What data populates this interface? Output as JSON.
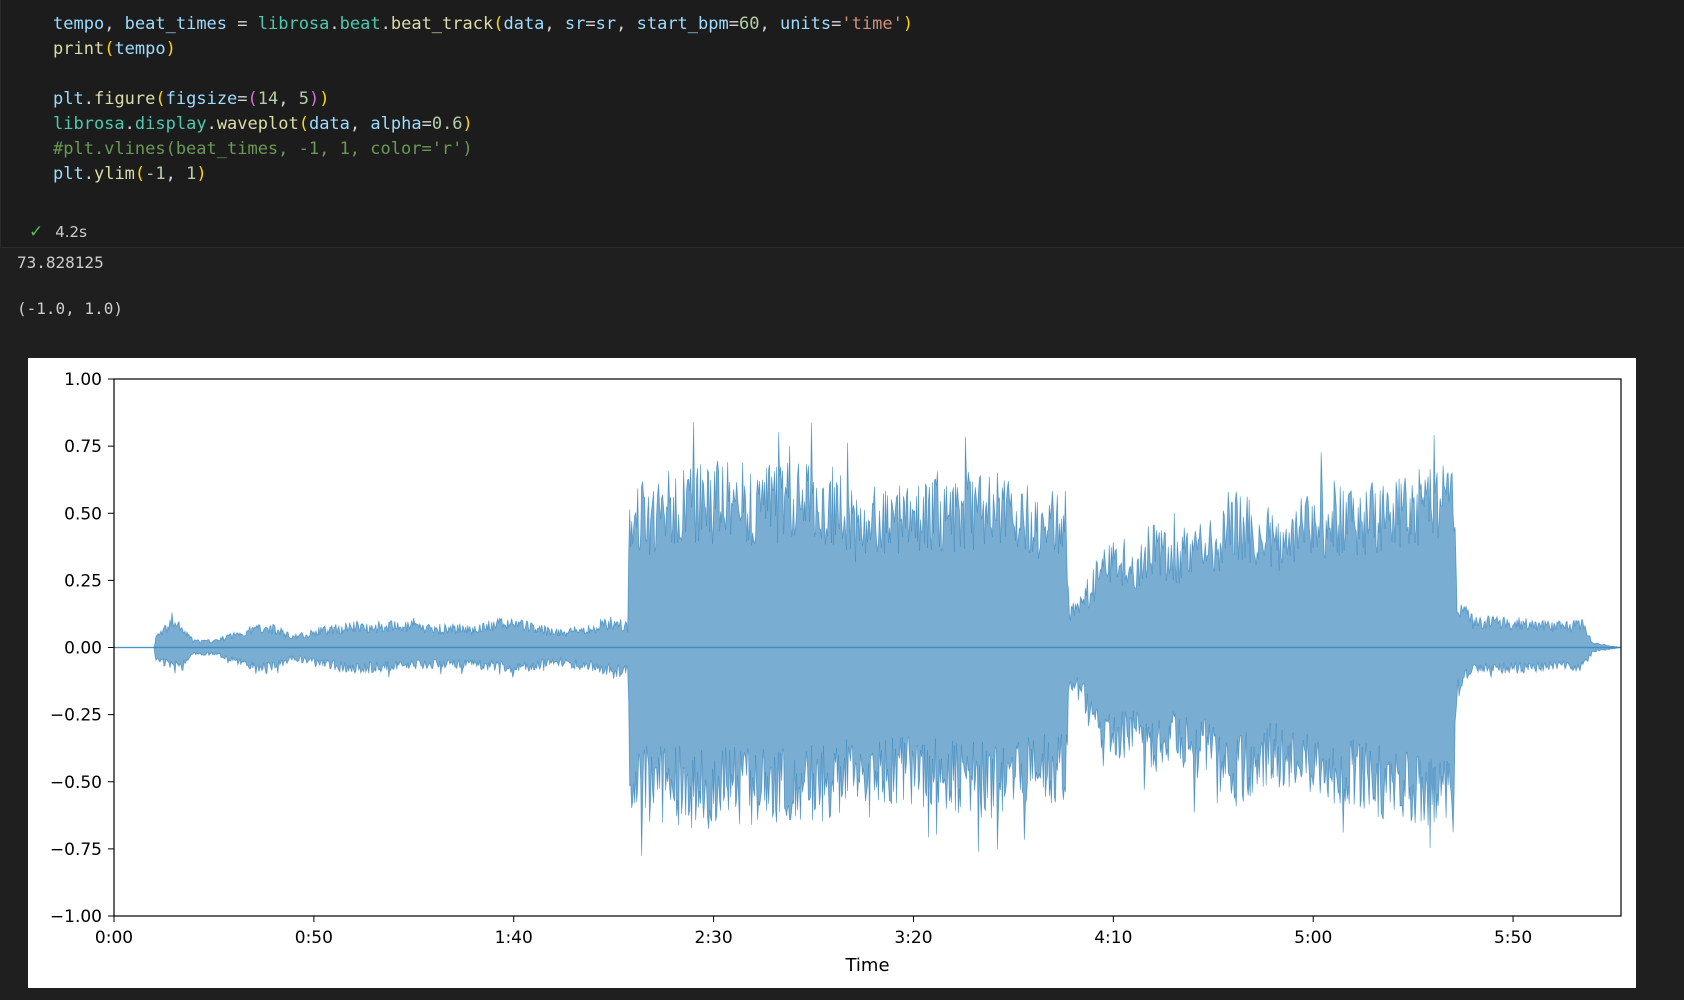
{
  "code_cell": {
    "lines": [
      [
        [
          "tempo",
          "v"
        ],
        [
          ", ",
          "op"
        ],
        [
          "beat_times",
          "v"
        ],
        [
          " = ",
          "op"
        ],
        [
          "librosa",
          "m"
        ],
        [
          ".",
          "op"
        ],
        [
          "beat",
          "m"
        ],
        [
          ".",
          "op"
        ],
        [
          "beat_track",
          "f"
        ],
        [
          "(",
          "p1"
        ],
        [
          "data",
          "v"
        ],
        [
          ", ",
          "op"
        ],
        [
          "sr",
          "v"
        ],
        [
          "=",
          "op"
        ],
        [
          "sr",
          "v"
        ],
        [
          ", ",
          "op"
        ],
        [
          "start_bpm",
          "v"
        ],
        [
          "=",
          "op"
        ],
        [
          "60",
          "n"
        ],
        [
          ", ",
          "op"
        ],
        [
          "units",
          "v"
        ],
        [
          "=",
          "op"
        ],
        [
          "'time'",
          "s"
        ],
        [
          ")",
          "p1"
        ]
      ],
      [
        [
          "print",
          "f"
        ],
        [
          "(",
          "p1"
        ],
        [
          "tempo",
          "v"
        ],
        [
          ")",
          "p1"
        ]
      ],
      [],
      [
        [
          "plt",
          "v"
        ],
        [
          ".",
          "op"
        ],
        [
          "figure",
          "f"
        ],
        [
          "(",
          "p1"
        ],
        [
          "figsize",
          "v"
        ],
        [
          "=",
          "op"
        ],
        [
          "(",
          "p2"
        ],
        [
          "14",
          "n"
        ],
        [
          ", ",
          "op"
        ],
        [
          "5",
          "n"
        ],
        [
          ")",
          "p2"
        ],
        [
          ")",
          "p1"
        ]
      ],
      [
        [
          "librosa",
          "m"
        ],
        [
          ".",
          "op"
        ],
        [
          "display",
          "m"
        ],
        [
          ".",
          "op"
        ],
        [
          "waveplot",
          "f"
        ],
        [
          "(",
          "p1"
        ],
        [
          "data",
          "v"
        ],
        [
          ", ",
          "op"
        ],
        [
          "alpha",
          "v"
        ],
        [
          "=",
          "op"
        ],
        [
          "0.6",
          "n"
        ],
        [
          ")",
          "p1"
        ]
      ],
      [
        [
          "#plt.vlines(beat_times, -1, 1, color='r')",
          "c"
        ]
      ],
      [
        [
          "plt",
          "v"
        ],
        [
          ".",
          "op"
        ],
        [
          "ylim",
          "f"
        ],
        [
          "(",
          "p1"
        ],
        [
          "-1",
          "n"
        ],
        [
          ", ",
          "op"
        ],
        [
          "1",
          "n"
        ],
        [
          ")",
          "p1"
        ]
      ]
    ]
  },
  "execution": {
    "status_icon": "check-icon",
    "duration": "4.2s"
  },
  "outputs": {
    "tempo_value": "73.828125",
    "ylim_value": "(-1.0, 1.0)"
  },
  "chart_data": {
    "type": "area",
    "title": "",
    "xlabel": "Time",
    "ylabel": "",
    "xlim": [
      0,
      377
    ],
    "ylim": [
      -1.0,
      1.0
    ],
    "x_ticks": [
      "0:00",
      "0:50",
      "1:40",
      "2:30",
      "3:20",
      "4:10",
      "5:00",
      "5:50"
    ],
    "x_tick_values": [
      0,
      50,
      100,
      150,
      200,
      250,
      300,
      350
    ],
    "y_ticks": [
      "1.00",
      "0.75",
      "0.50",
      "0.25",
      "0.00",
      "−0.25",
      "−0.50",
      "−0.75",
      "−1.00"
    ],
    "y_tick_values": [
      1.0,
      0.75,
      0.5,
      0.25,
      0.0,
      -0.25,
      -0.5,
      -0.75,
      -1.0
    ],
    "series": [
      {
        "color": "#1f77b4",
        "alpha": 0.6,
        "envelope": {
          "x": [
            0,
            10,
            10.5,
            15,
            20,
            25,
            30,
            38,
            45,
            52,
            60,
            70,
            80,
            90,
            100,
            110,
            120,
            125,
            128.5,
            129,
            135,
            140,
            150,
            160,
            170,
            180,
            185,
            186,
            190,
            200,
            210,
            220,
            230,
            238,
            239,
            245,
            250,
            255,
            260,
            265,
            270,
            275,
            280,
            290,
            300,
            310,
            320,
            335,
            336,
            340,
            350,
            360,
            365,
            367,
            370,
            377
          ],
          "upper": [
            0.0,
            0.0,
            0.05,
            0.12,
            0.03,
            0.03,
            0.06,
            0.1,
            0.05,
            0.08,
            0.1,
            0.1,
            0.09,
            0.09,
            0.12,
            0.07,
            0.09,
            0.12,
            0.1,
            0.6,
            0.62,
            0.68,
            0.7,
            0.68,
            0.7,
            0.68,
            0.6,
            0.55,
            0.6,
            0.62,
            0.64,
            0.67,
            0.6,
            0.6,
            0.15,
            0.3,
            0.45,
            0.38,
            0.5,
            0.4,
            0.5,
            0.45,
            0.6,
            0.5,
            0.6,
            0.6,
            0.64,
            0.7,
            0.2,
            0.12,
            0.12,
            0.1,
            0.1,
            0.12,
            0.02,
            0.0
          ],
          "lower": [
            0.0,
            0.0,
            -0.05,
            -0.1,
            -0.03,
            -0.03,
            -0.06,
            -0.1,
            -0.05,
            -0.08,
            -0.1,
            -0.09,
            -0.08,
            -0.08,
            -0.1,
            -0.07,
            -0.09,
            -0.12,
            -0.1,
            -0.62,
            -0.66,
            -0.66,
            -0.68,
            -0.66,
            -0.66,
            -0.64,
            -0.6,
            -0.58,
            -0.6,
            -0.6,
            -0.62,
            -0.64,
            -0.58,
            -0.58,
            -0.15,
            -0.3,
            -0.45,
            -0.38,
            -0.5,
            -0.4,
            -0.5,
            -0.45,
            -0.6,
            -0.5,
            -0.6,
            -0.62,
            -0.65,
            -0.7,
            -0.2,
            -0.1,
            -0.1,
            -0.09,
            -0.09,
            -0.1,
            -0.02,
            0.0
          ]
        }
      }
    ]
  }
}
